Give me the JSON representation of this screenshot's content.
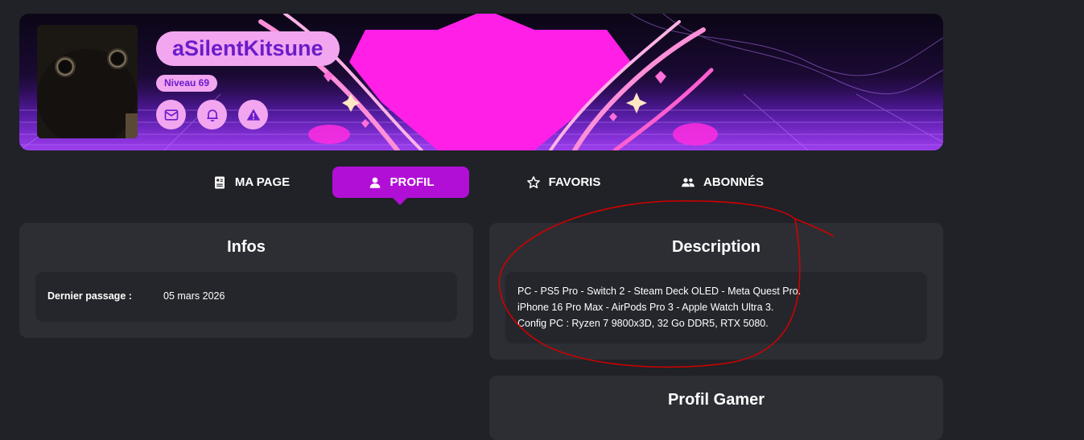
{
  "profile": {
    "username": "aSilentKitsune",
    "level": "Niveau 69",
    "actions": [
      "mail-icon",
      "bell-icon",
      "warning-icon"
    ]
  },
  "tabs": [
    {
      "label": "MA PAGE",
      "icon": "id-card-icon",
      "active": false
    },
    {
      "label": "PROFIL",
      "icon": "user-icon",
      "active": true
    },
    {
      "label": "FAVORIS",
      "icon": "star-icon",
      "active": false
    },
    {
      "label": "ABONNÉS",
      "icon": "users-icon",
      "active": false
    }
  ],
  "infos": {
    "title": "Infos",
    "rows": [
      {
        "label": "Dernier passage :",
        "value": "05 mars 2026"
      }
    ]
  },
  "description": {
    "title": "Description",
    "lines": [
      "PC - PS5 Pro - Switch 2 - Steam Deck OLED - Meta Quest Pro.",
      "iPhone 16 Pro Max - AirPods Pro 3 - Apple Watch Ultra 3.",
      "Config PC : Ryzen 7 9800x3D, 32 Go DDR5, RTX 5080."
    ]
  },
  "gamer_profile": {
    "title": "Profil Gamer"
  },
  "colors": {
    "background": "#202227",
    "card": "#2c2e34",
    "inner_card": "#24262b",
    "accent": "#b10fd6",
    "pill": "#f2a6f0",
    "pill_text": "#6a1cc9",
    "annotation": "#d00000"
  }
}
